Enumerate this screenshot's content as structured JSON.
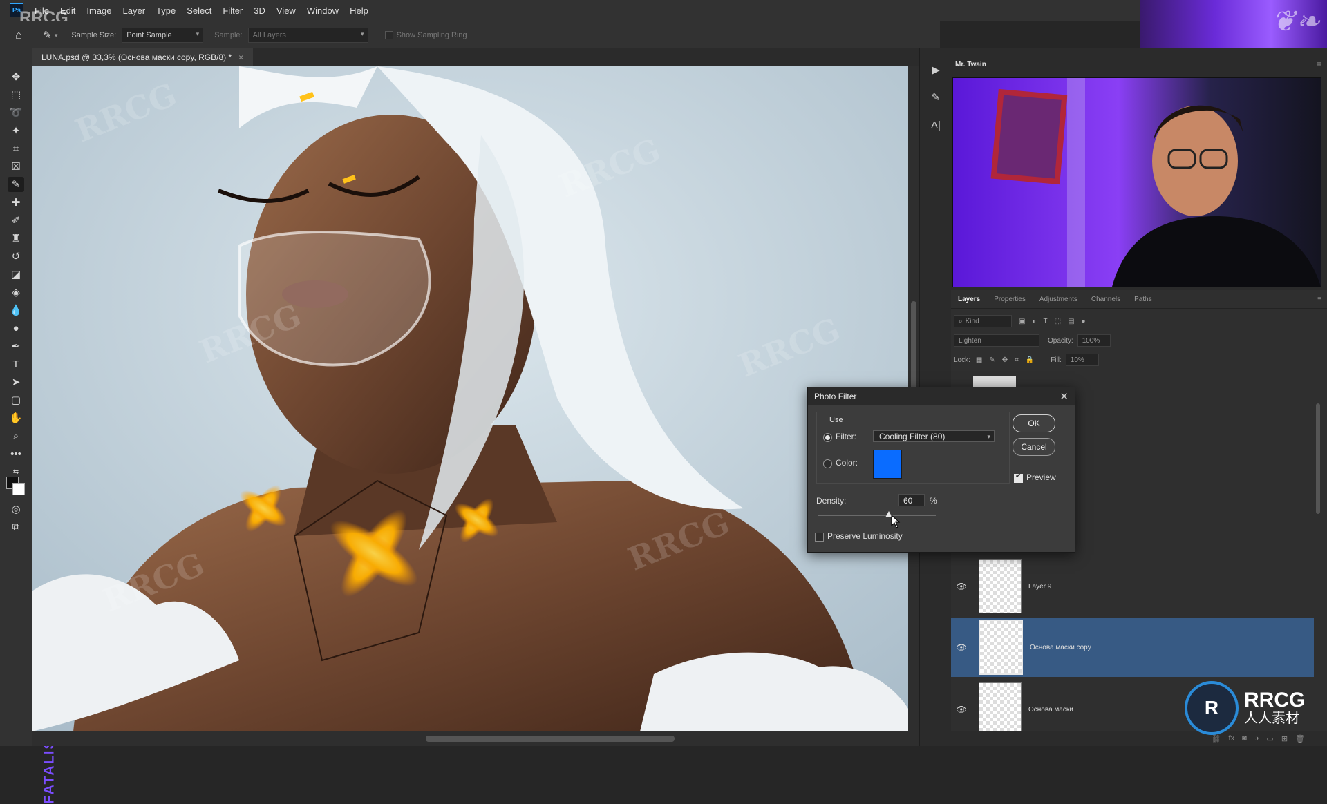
{
  "menubar": {
    "items": [
      "File",
      "Edit",
      "Image",
      "Layer",
      "Type",
      "Select",
      "Filter",
      "3D",
      "View",
      "Window",
      "Help"
    ]
  },
  "options": {
    "sample_size_label": "Sample Size:",
    "sample_size_value": "Point Sample",
    "sample_label": "Sample:",
    "sample_value": "All Layers",
    "show_ring_label": "Show Sampling Ring"
  },
  "document": {
    "tab_title": "LUNA.psd @ 33,3% (Основа маски copy, RGB/8) *",
    "close": "×"
  },
  "webcam": {
    "title": "Mr. Twain"
  },
  "layers_panel": {
    "tabs": [
      "Layers",
      "Properties",
      "Adjustments",
      "Channels",
      "Paths"
    ],
    "kind_label": "Kind",
    "blend_mode": "Lighten",
    "opacity_label": "Opacity:",
    "opacity_value": "100%",
    "lock_label": "Lock:",
    "fill_label": "Fill:",
    "fill_value": "10%",
    "layers": [
      {
        "name": "Layer 9"
      },
      {
        "name": "Основа маски copy"
      },
      {
        "name": "Основа маски"
      }
    ]
  },
  "dialog": {
    "title": "Photo Filter",
    "use_label": "Use",
    "filter_label": "Filter:",
    "filter_value": "Cooling Filter (80)",
    "color_label": "Color:",
    "color_value": "#0a6cff",
    "ok_label": "OK",
    "cancel_label": "Cancel",
    "preview_label": "Preview",
    "preview_checked": true,
    "density_label": "Density:",
    "density_value": "60",
    "density_unit": "%",
    "preserve_label": "Preserve Luminosity",
    "preserve_checked": false
  },
  "side_brand": "FATALISM CYBERFUNK",
  "watermark": {
    "corner": "RRCG",
    "text": "RRCG",
    "logo_main": "RRCG",
    "logo_sub": "人人素材"
  }
}
